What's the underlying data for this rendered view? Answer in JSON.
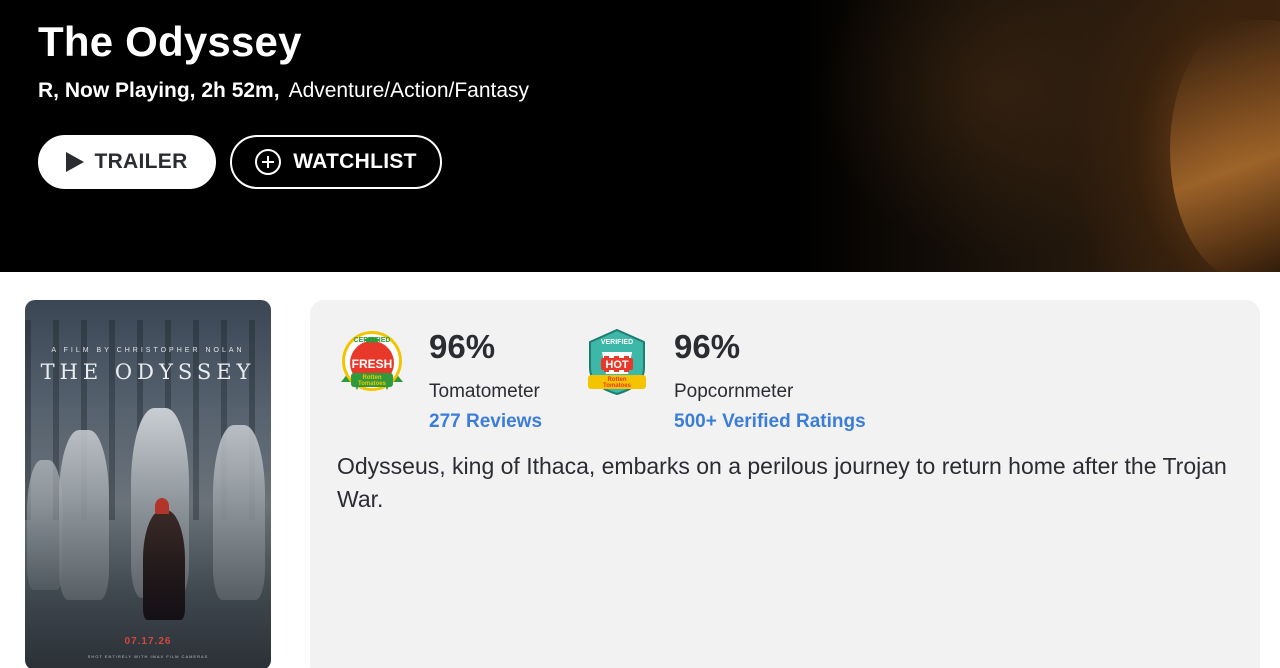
{
  "movie": {
    "title": "The Odyssey",
    "meta_info": "R, Now Playing, 2h 52m,",
    "genres": "Adventure/Action/Fantasy"
  },
  "actions": {
    "trailer_label": "TRAILER",
    "watchlist_label": "WATCHLIST"
  },
  "poster": {
    "tagline": "A FILM BY CHRISTOPHER NOLAN",
    "title": "THE ODYSSEY",
    "release_date": "07.17.26",
    "footer": "SHOT ENTIRELY WITH IMAX FILM CAMERAS"
  },
  "scores": {
    "tomatometer": {
      "badge_top": "CERTIFIED",
      "badge_main": "FRESH",
      "badge_sub1": "Rotten",
      "badge_sub2": "Tomatoes",
      "value": "96%",
      "label": "Tomatometer",
      "link": "277 Reviews"
    },
    "popcornmeter": {
      "badge_top": "VERIFIED",
      "badge_main": "HOT",
      "badge_sub1": "Rotten",
      "badge_sub2": "Tomatoes",
      "value": "96%",
      "label": "Popcornmeter",
      "link": "500+ Verified Ratings"
    }
  },
  "synopsis": "Odysseus, king of Ithaca, embarks on a perilous journey to return home after the Trojan War.",
  "icons": {
    "trailer": "play-icon",
    "watchlist": "plus-circle-icon",
    "tomatometer": "certified-fresh-icon",
    "popcornmeter": "verified-hot-icon"
  },
  "colors": {
    "link": "#3b7dd8",
    "fresh_red": "#e8382a",
    "fresh_green": "#2e9a3c",
    "hot_teal": "#3cb7a8",
    "badge_yellow": "#f5c400"
  }
}
